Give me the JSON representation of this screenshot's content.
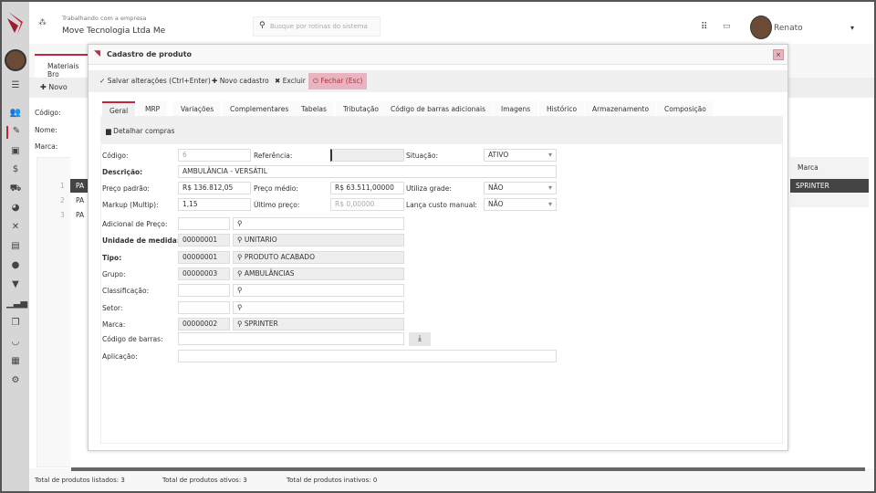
{
  "header": {
    "working_label": "Trabalhando com a empresa",
    "company": "Move Tecnologia Ltda Me",
    "search_placeholder": "Busque por rotinas do sistema",
    "user": "Renato"
  },
  "background": {
    "tab": "Materiais Bro",
    "new_label": "Novo",
    "filters": [
      "Código:",
      "Nome:",
      "Marca:"
    ],
    "row_numbers": [
      "1",
      "2",
      "3"
    ],
    "row_prefix": "PA",
    "col_marca": "Marca",
    "marca_value": "SPRINTER",
    "footer": {
      "listed_label": "Total de produtos listados:",
      "listed": "3",
      "active_label": "Total de produtos ativos:",
      "active": "3",
      "inactive_label": "Total de produtos inativos:",
      "inactive": "0"
    }
  },
  "modal": {
    "title": "Cadastro de produto",
    "toolbar": {
      "save": "Salvar alterações (Ctrl+Enter)",
      "new": "Novo cadastro",
      "delete": "Excluir",
      "close": "Fechar (Esc)"
    },
    "tabs": [
      "Geral",
      "MRP",
      "Variações",
      "Complementares",
      "Tabelas",
      "Tributação",
      "Código de barras adicionais",
      "Imagens",
      "Histórico",
      "Armazenamento",
      "Composição"
    ],
    "detail_purchases": "Detalhar compras",
    "form": {
      "codigo_label": "Código:",
      "codigo": "6",
      "referencia_label": "Referência:",
      "referencia": "",
      "situacao_label": "Situação:",
      "situacao": "ATIVO",
      "descricao_label": "Descrição:",
      "descricao": "AMBULÂNCIA - VERSÁTIL",
      "preco_padrao_label": "Preço padrão:",
      "preco_padrao": "R$ 136.812,05",
      "preco_medio_label": "Preço médio:",
      "preco_medio": "R$ 63.511,00000",
      "utiliza_grade_label": "Utiliza grade:",
      "utiliza_grade": "NÃO",
      "markup_label": "Markup (Multip):",
      "markup": "1,15",
      "ultimo_preco_label": "Último preço:",
      "ultimo_preco": "R$ 0,00000",
      "lanca_custo_label": "Lança custo manual:",
      "lanca_custo": "NÃO",
      "lookups": [
        {
          "label": "Adicional de Preço:",
          "code": "",
          "value": "",
          "bold": false,
          "ro": false
        },
        {
          "label": "Unidade de medida:",
          "code": "00000001",
          "value": "UNITARIO",
          "bold": true,
          "ro": true
        },
        {
          "label": "Tipo:",
          "code": "00000001",
          "value": "PRODUTO ACABADO",
          "bold": true,
          "ro": true
        },
        {
          "label": "Grupo:",
          "code": "00000003",
          "value": "AMBULÂNCIAS",
          "bold": false,
          "ro": true
        },
        {
          "label": "Classificação:",
          "code": "",
          "value": "",
          "bold": false,
          "ro": false
        },
        {
          "label": "Setor:",
          "code": "",
          "value": "",
          "bold": false,
          "ro": false
        },
        {
          "label": "Marca:",
          "code": "00000002",
          "value": "SPRINTER",
          "bold": false,
          "ro": true
        }
      ],
      "barcode_label": "Código de barras:",
      "barcode": "",
      "aplicacao_label": "Aplicação:",
      "aplicacao": ""
    }
  },
  "colors": {
    "brand": "#c0263e",
    "dark_row": "#444444",
    "close_bg": "#e8b4c2"
  }
}
